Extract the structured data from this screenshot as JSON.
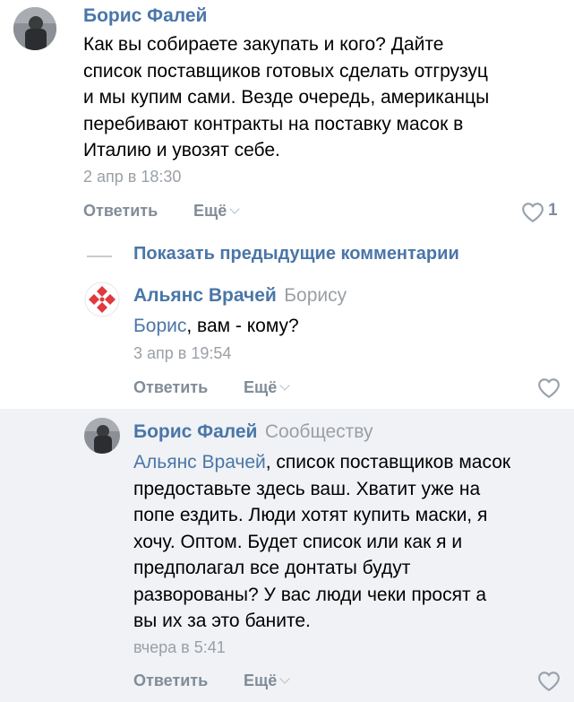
{
  "comments": [
    {
      "author": "Борис Фалей",
      "reply_to": "",
      "mention": "",
      "text_lines": [
        "Как вы собираете закупать и кого? Дайте",
        "список поставщиков готовых сделать отгрузуц",
        "и мы купим сами. Везде очередь, американцы",
        "перебивают контракты на поставку масок в",
        "Италию и увозят себе."
      ],
      "timestamp": "2 апр в 18:30",
      "reply_label": "Ответить",
      "more_label": "Ещё",
      "likes": "1"
    },
    {
      "author": "Альянс Врачей",
      "reply_to": "Борису",
      "mention": "Борис",
      "text_after_mention": ", вам - кому?",
      "timestamp": "3 апр в 19:54",
      "reply_label": "Ответить",
      "more_label": "Ещё"
    },
    {
      "author": "Борис Фалей",
      "reply_to": "Сообществу",
      "mention": "Альянс Врачей",
      "first_line_after_mention": ", список поставщиков масок",
      "text_lines": [
        "предоставьте здесь ваш. Хватит уже на",
        "попе ездить. Люди хотят купить маски, я",
        "хочу. Оптом. Будет список или как я и",
        "предполагал все донтаты будут",
        "разворованы? У вас люди чеки просят а",
        "вы их за это баните."
      ],
      "timestamp": "вчера в 5:41",
      "reply_label": "Ответить",
      "more_label": "Ещё"
    }
  ],
  "show_previous": "Показать предыдущие комментарии",
  "colors": {
    "link": "#4a76a8",
    "muted": "#818c99",
    "highlight_bg": "#f0f2f5",
    "logo_red": "#e0393e"
  },
  "icons": [
    "avatar-photo",
    "alliance-logo",
    "heart-icon",
    "chevron-down-icon"
  ]
}
